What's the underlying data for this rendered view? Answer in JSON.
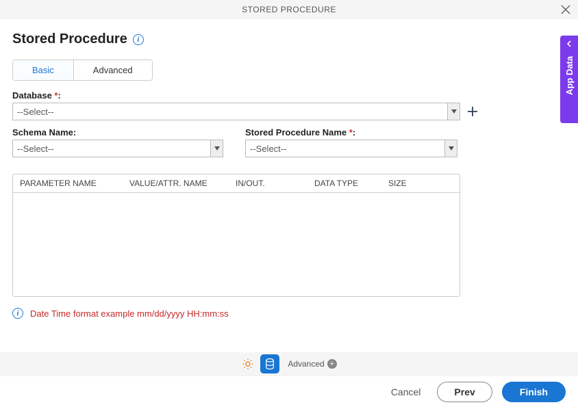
{
  "header": {
    "title": "STORED PROCEDURE"
  },
  "sideTab": {
    "label": "App Data"
  },
  "page": {
    "title": "Stored Procedure"
  },
  "tabs": {
    "basic": "Basic",
    "advanced": "Advanced"
  },
  "form": {
    "database": {
      "label": "Database ",
      "value": "--Select--"
    },
    "schema": {
      "label": "Schema Name:",
      "value": "--Select--"
    },
    "spname": {
      "label": "Stored Procedure Name ",
      "value": "--Select--"
    }
  },
  "table": {
    "headers": [
      "PARAMETER NAME",
      "VALUE/ATTR. NAME",
      "IN/OUT.",
      "DATA TYPE",
      "SIZE"
    ]
  },
  "hint": "Date Time format example mm/dd/yyyy HH:mm:ss",
  "bottomBar": {
    "advanced": "Advanced"
  },
  "buttons": {
    "cancel": "Cancel",
    "prev": "Prev",
    "finish": "Finish"
  },
  "required": "*",
  "colon": ":"
}
